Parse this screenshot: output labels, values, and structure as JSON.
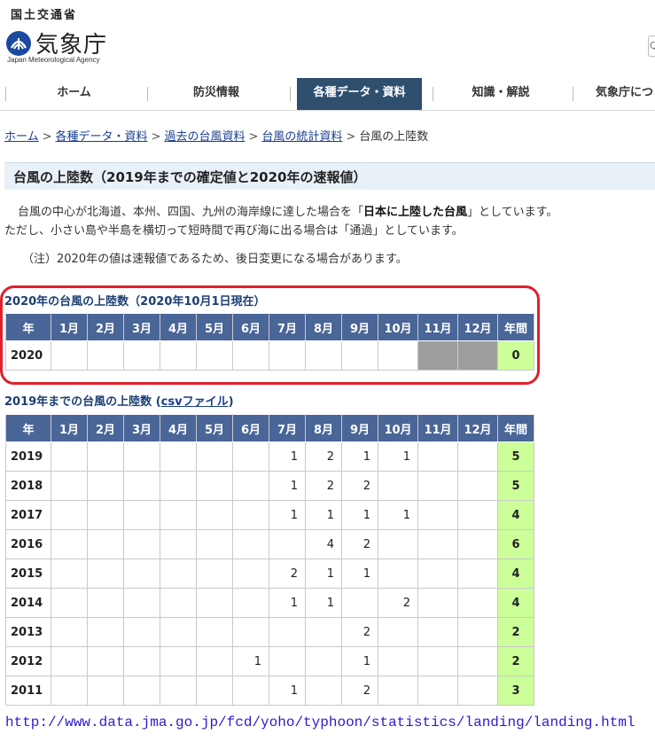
{
  "header": {
    "ministry": "国土交通省",
    "agency_name": "気象庁",
    "agency_en": "Japan Meteorological Agency",
    "logo_icon": "jma-logo-icon",
    "search_edge_glyph": "Q"
  },
  "nav": {
    "items": [
      {
        "label": "ホーム"
      },
      {
        "label": "防災情報"
      },
      {
        "label": "各種データ・資料",
        "active": true
      },
      {
        "label": "知識・解説"
      },
      {
        "label": "気象庁につ"
      }
    ]
  },
  "breadcrumb": {
    "items": [
      "ホーム",
      "各種データ・資料",
      "過去の台風資料",
      "台風の統計資料"
    ],
    "current": "台風の上陸数",
    "separator": ">"
  },
  "page": {
    "title": "台風の上陸数（2019年までの確定値と2020年の速報値）",
    "desc1_pre": "台風の中心が北海道、本州、四国、九州の海岸線に達した場合を「",
    "desc1_bold": "日本に上陸した台風",
    "desc1_post": "」としています。",
    "desc2": "ただし、小さい島や半島を横切って短時間で再び海に出る場合は「通過」としています。",
    "note": "（注）2020年の値は速報値であるため、後日変更になる場合があります。"
  },
  "table_headers": [
    "年",
    "1月",
    "2月",
    "3月",
    "4月",
    "5月",
    "6月",
    "7月",
    "8月",
    "9月",
    "10月",
    "11月",
    "12月",
    "年間"
  ],
  "table2020": {
    "caption": "2020年の台風の上陸数（2020年10月1日現在）",
    "year": "2020",
    "months": [
      "",
      "",
      "",
      "",
      "",
      "",
      "",
      "",
      "",
      "",
      "",
      ""
    ],
    "unavailable_months": [
      11,
      12
    ],
    "total": "0"
  },
  "table_hist": {
    "caption_pre": "2019年までの台風の上陸数 (",
    "caption_link": "csvファイル",
    "caption_post": ")",
    "rows": [
      {
        "year": "2019",
        "months": [
          "",
          "",
          "",
          "",
          "",
          "",
          "1",
          "2",
          "1",
          "1",
          "",
          ""
        ],
        "total": "5"
      },
      {
        "year": "2018",
        "months": [
          "",
          "",
          "",
          "",
          "",
          "",
          "1",
          "2",
          "2",
          "",
          "",
          ""
        ],
        "total": "5"
      },
      {
        "year": "2017",
        "months": [
          "",
          "",
          "",
          "",
          "",
          "",
          "1",
          "1",
          "1",
          "1",
          "",
          ""
        ],
        "total": "4"
      },
      {
        "year": "2016",
        "months": [
          "",
          "",
          "",
          "",
          "",
          "",
          "",
          "4",
          "2",
          "",
          "",
          ""
        ],
        "total": "6"
      },
      {
        "year": "2015",
        "months": [
          "",
          "",
          "",
          "",
          "",
          "",
          "2",
          "1",
          "1",
          "",
          "",
          ""
        ],
        "total": "4"
      },
      {
        "year": "2014",
        "months": [
          "",
          "",
          "",
          "",
          "",
          "",
          "1",
          "1",
          "",
          "2",
          "",
          ""
        ],
        "total": "4"
      },
      {
        "year": "2013",
        "months": [
          "",
          "",
          "",
          "",
          "",
          "",
          "",
          "",
          "2",
          "",
          "",
          ""
        ],
        "total": "2"
      },
      {
        "year": "2012",
        "months": [
          "",
          "",
          "",
          "",
          "",
          "1",
          "",
          "",
          "1",
          "",
          "",
          ""
        ],
        "total": "2"
      },
      {
        "year": "2011",
        "months": [
          "",
          "",
          "",
          "",
          "",
          "",
          "1",
          "",
          "2",
          "",
          "",
          ""
        ],
        "total": "3"
      }
    ]
  },
  "source_url": "http://www.data.jma.go.jp/fcd/yoho/typhoon/statistics/landing/landing.html",
  "colors": {
    "header_cell": "#4a6597",
    "total_cell": "#ccff99",
    "unavailable_cell": "#9e9e9e",
    "nav_active": "#2f4f6f",
    "highlight_ring": "#e0202a",
    "url_text": "#2a1ccc"
  }
}
